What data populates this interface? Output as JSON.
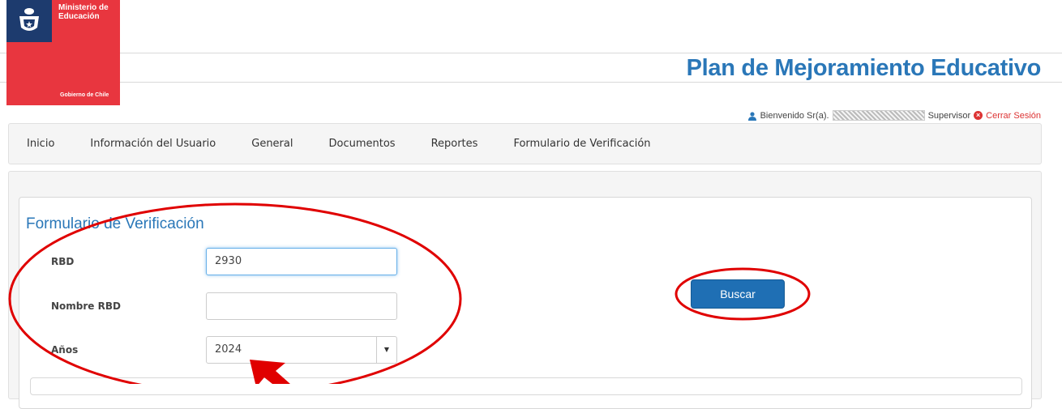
{
  "header": {
    "ministry": "Ministerio de Educación",
    "ministry_line1": "Ministerio de",
    "ministry_line2": "Educación",
    "government": "Gobierno de Chile",
    "app_title": "Plan de Mejoramiento Educativo",
    "welcome": "Bienvenido Sr(a).",
    "role": "Supervisor",
    "logout": "Cerrar Sesión"
  },
  "nav": {
    "items": [
      "Inicio",
      "Información del Usuario",
      "General",
      "Documentos",
      "Reportes",
      "Formulario de Verificación"
    ]
  },
  "form": {
    "title": "Formulario de Verificación",
    "rbd_label": "RBD",
    "rbd_value": "2930",
    "nombre_label": "Nombre RBD",
    "nombre_value": "",
    "anos_label": "Años",
    "anos_value": "2024",
    "search_button": "Buscar"
  },
  "colors": {
    "brand_blue": "#2a77b8",
    "gov_red": "#e8363f",
    "gov_blue": "#1d3b6e",
    "button_blue": "#1f6fb4",
    "annotation_red": "#e00000"
  }
}
